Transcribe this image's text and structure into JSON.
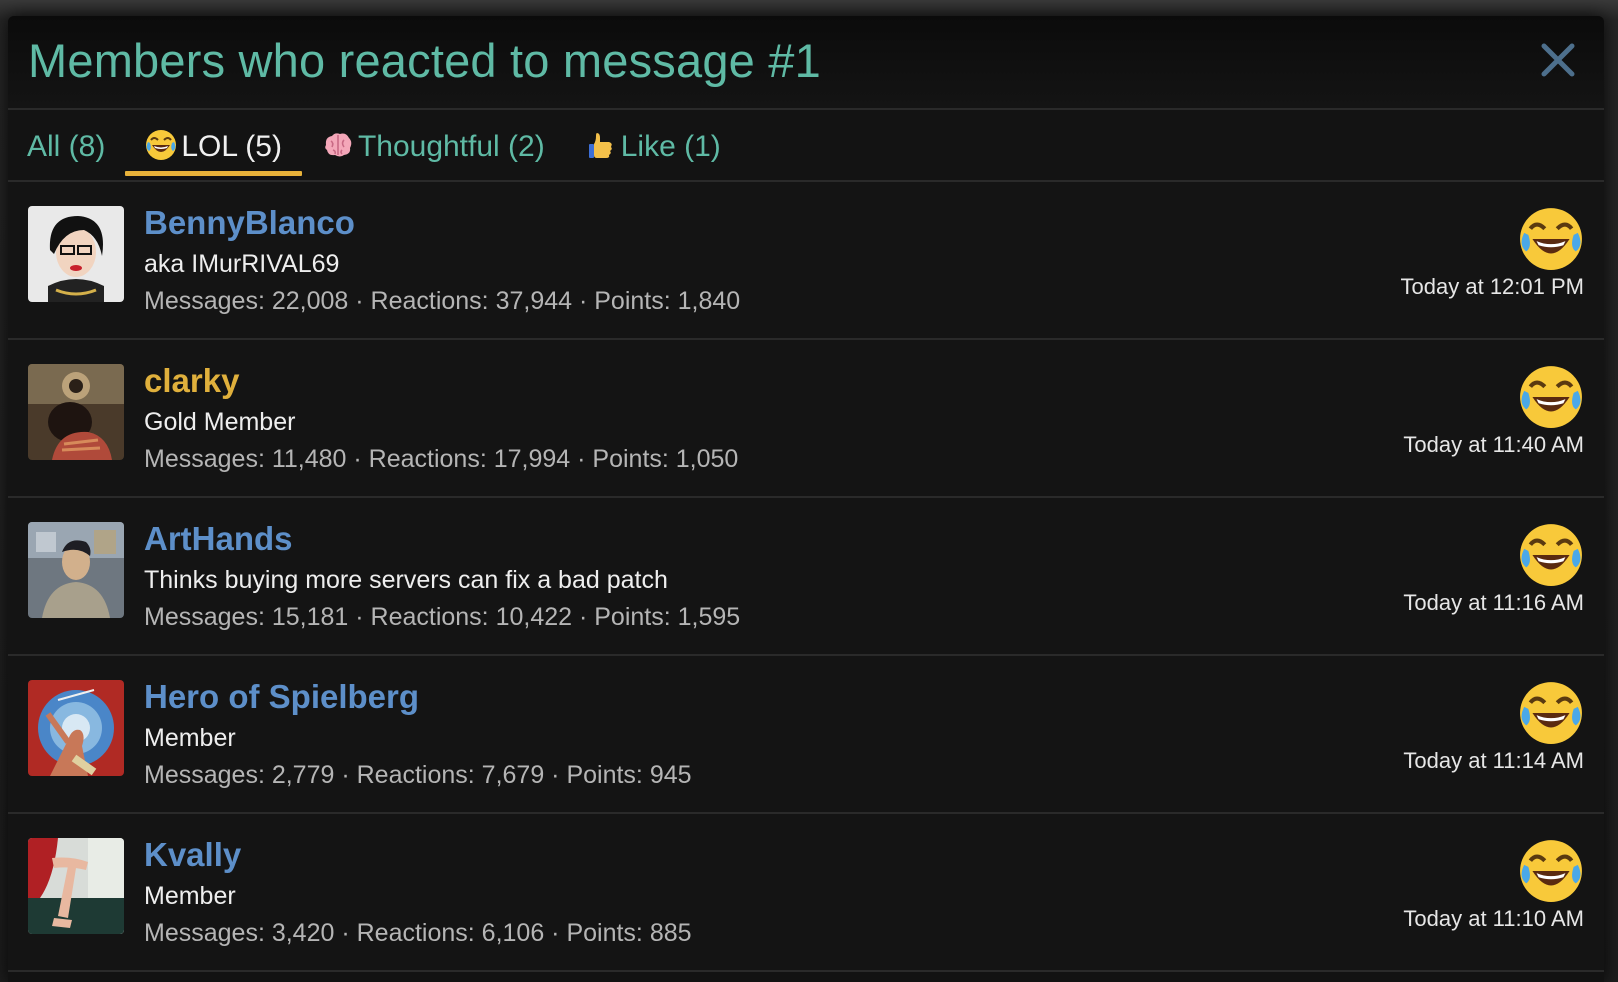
{
  "overlay": {
    "title": "Members who reacted to message #1",
    "close_icon": "close-icon"
  },
  "tabs": [
    {
      "label": "All (8)",
      "icon": "",
      "active": false
    },
    {
      "label": "LOL (5)",
      "icon": "laughing-tears-emoji",
      "active": true
    },
    {
      "label": "Thoughtful (2)",
      "icon": "brain-emoji",
      "active": false
    },
    {
      "label": "Like (1)",
      "icon": "thumbs-up-emoji",
      "active": false
    }
  ],
  "members": [
    {
      "name": "BennyBlanco",
      "title": "aka IMurRIVAL69",
      "stats": "Messages: 22,008 · Reactions: 37,944 · Points: 1,840",
      "time": "Today at 12:01 PM",
      "reaction": "laughing-tears-emoji",
      "name_color": "#5d8fc9"
    },
    {
      "name": "clarky",
      "title": "Gold Member",
      "stats": "Messages: 11,480 · Reactions: 17,994 · Points: 1,050",
      "time": "Today at 11:40 AM",
      "reaction": "laughing-tears-emoji",
      "name_color": "#e0b03c"
    },
    {
      "name": "ArtHands",
      "title": "Thinks buying more servers can fix a bad patch",
      "stats": "Messages: 15,181 · Reactions: 10,422 · Points: 1,595",
      "time": "Today at 11:16 AM",
      "reaction": "laughing-tears-emoji",
      "name_color": "#5d8fc9"
    },
    {
      "name": "Hero of Spielberg",
      "title": "Member",
      "stats": "Messages: 2,779 · Reactions: 7,679 · Points: 945",
      "time": "Today at 11:14 AM",
      "reaction": "laughing-tears-emoji",
      "name_color": "#5d8fc9"
    },
    {
      "name": "Kvally",
      "title": "Member",
      "stats": "Messages: 3,420 · Reactions: 6,106 · Points: 885",
      "time": "Today at 11:10 AM",
      "reaction": "laughing-tears-emoji",
      "name_color": "#5d8fc9"
    }
  ],
  "colors": {
    "accent_teal": "#5fbaa5",
    "username_blue": "#5d8fc9",
    "username_gold": "#e0b03c",
    "tab_underline": "#e8b23a",
    "background": "#121212"
  }
}
